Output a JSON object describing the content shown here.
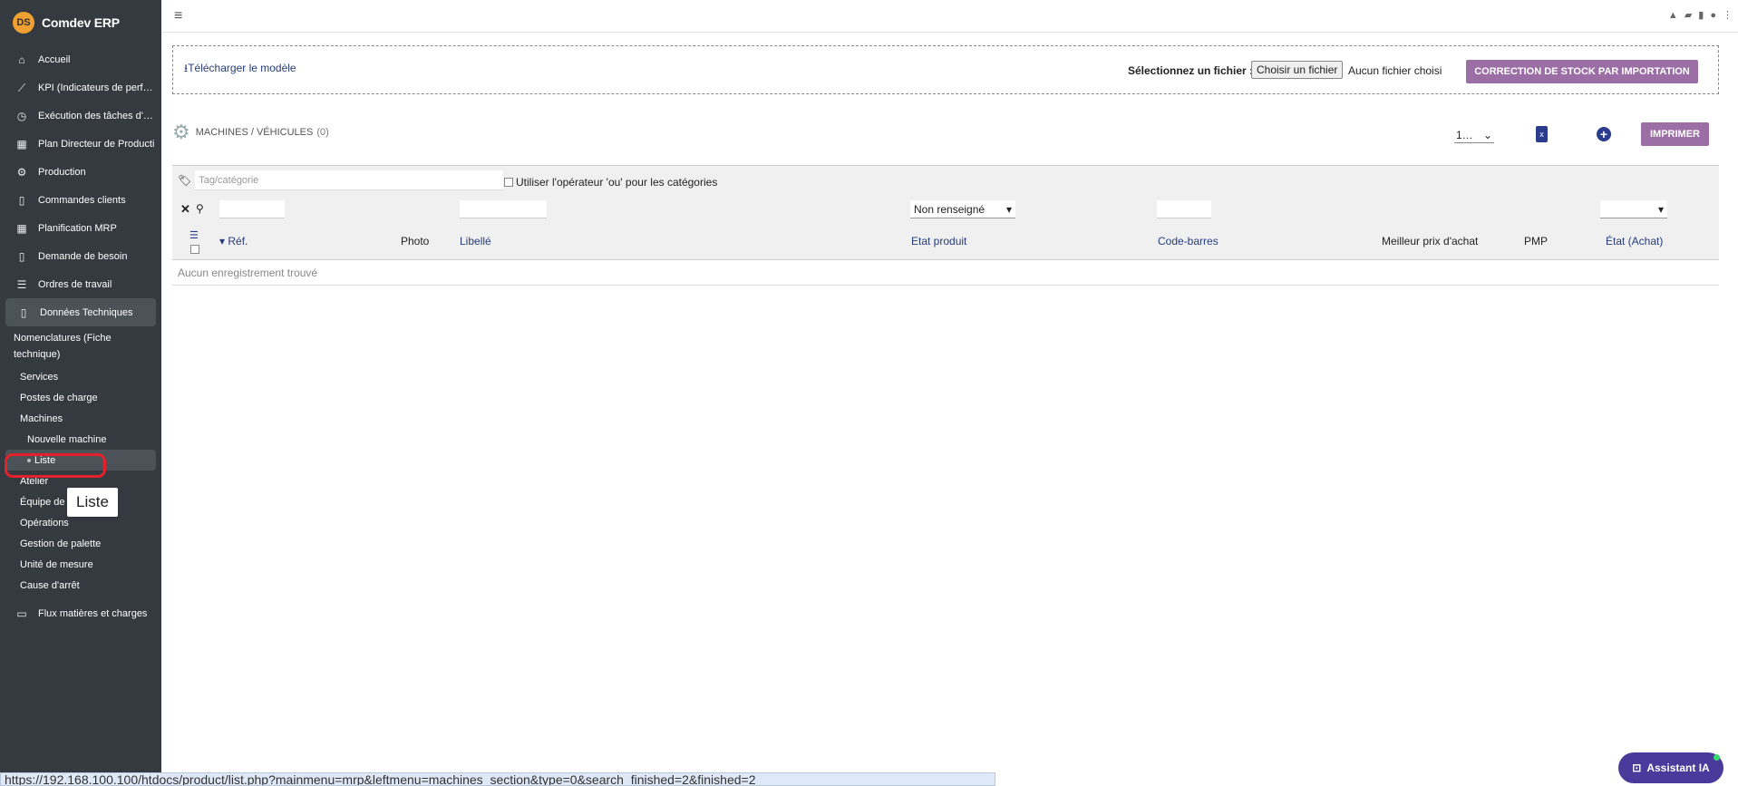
{
  "app": {
    "name": "Comdev ERP",
    "logo_text": "DS"
  },
  "sidebar": {
    "items": [
      {
        "label": "Accueil",
        "icon": "home-icon",
        "glyph": "⌂"
      },
      {
        "label": "KPI (Indicateurs de perf…",
        "icon": "chart-line-icon",
        "glyph": "📈"
      },
      {
        "label": "Exécution des tâches d'…",
        "icon": "clock-icon",
        "glyph": "◷"
      },
      {
        "label": "Plan Directeur de Producti",
        "icon": "calendar-icon",
        "glyph": "▦"
      },
      {
        "label": "Production",
        "icon": "gears-icon",
        "glyph": "⚙"
      },
      {
        "label": "Commandes clients",
        "icon": "document-icon",
        "glyph": "🗎"
      },
      {
        "label": "Planification MRP",
        "icon": "calendar-icon",
        "glyph": "▦"
      },
      {
        "label": "Demande de besoin",
        "icon": "document-icon",
        "glyph": "🗎"
      },
      {
        "label": "Ordres de travail",
        "icon": "list-check-icon",
        "glyph": "☰"
      },
      {
        "label": "Données Techniques",
        "icon": "document-icon",
        "glyph": "🗎"
      }
    ],
    "sub_items": {
      "nomenclatures": "Nomenclatures (Fiche technique)",
      "services": "Services",
      "postes": "Postes de charge",
      "machines": "Machines",
      "nouvelle_machine": "Nouvelle machine",
      "liste": "Liste",
      "atelier": "Atelier",
      "equipe": "Équipe de",
      "operations": "Opérations",
      "palette": "Gestion de palette",
      "unite": "Unité de mesure",
      "cause": "Cause d'arrêt"
    },
    "flux": {
      "label": "Flux matières et charges",
      "icon": "truck-icon",
      "glyph": "🚚"
    },
    "tooltip": "Liste"
  },
  "import": {
    "download_label": "Télécharger le modèle",
    "file_label": "Sélectionnez un fichier :",
    "choose_button": "Choisir un fichier",
    "no_file": "Aucun fichier choisi",
    "submit_button": "CORRECTION DE STOCK PAR IMPORTATION"
  },
  "list": {
    "title": "MACHINES / VÉHICULES",
    "count": "(0)",
    "page_size": "1…",
    "print_button": "IMPRIMER",
    "tag_placeholder": "Tag/catégorie",
    "or_operator_label": "Utiliser l'opérateur 'ou' pour les catégories",
    "etat_filter": "Non renseigné",
    "columns": {
      "ref": "Réf.",
      "photo": "Photo",
      "libelle": "Libellé",
      "etat_produit": "Etat produit",
      "code_barres": "Code-barres",
      "meilleur_prix": "Meilleur prix d'achat",
      "pmp": "PMP",
      "etat_achat": "État (Achat)"
    },
    "empty": "Aucun enregistrement trouvé"
  },
  "status_url": "https://192.168.100.100/htdocs/product/list.php?mainmenu=mrp&leftmenu=machines_section&type=0&search_finished=2&finished=2",
  "assistant": {
    "label": "Assistant IA"
  },
  "colors": {
    "sidebar_bg": "#343a40",
    "accent_button": "#9b6fa6",
    "link": "#263c7a",
    "assistant": "#4a3a9c"
  }
}
